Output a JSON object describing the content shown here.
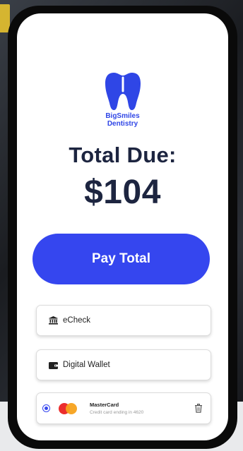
{
  "brand": {
    "line1": "BigSmiles",
    "line2": "Dentistry",
    "color": "#2f46e6"
  },
  "summary": {
    "label": "Total Due:",
    "amount": "$104"
  },
  "pay_button": {
    "label": "Pay Total",
    "color": "#3546ef"
  },
  "payment_options": [
    {
      "label": "eCheck",
      "icon": "bank-icon"
    },
    {
      "label": "Digital Wallet",
      "icon": "wallet-icon"
    }
  ],
  "saved_card": {
    "name": "MasterCard",
    "detail": "Credit card ending in 4620",
    "selected": true,
    "icon": "mastercard-icon",
    "delete_icon": "trash-icon"
  }
}
